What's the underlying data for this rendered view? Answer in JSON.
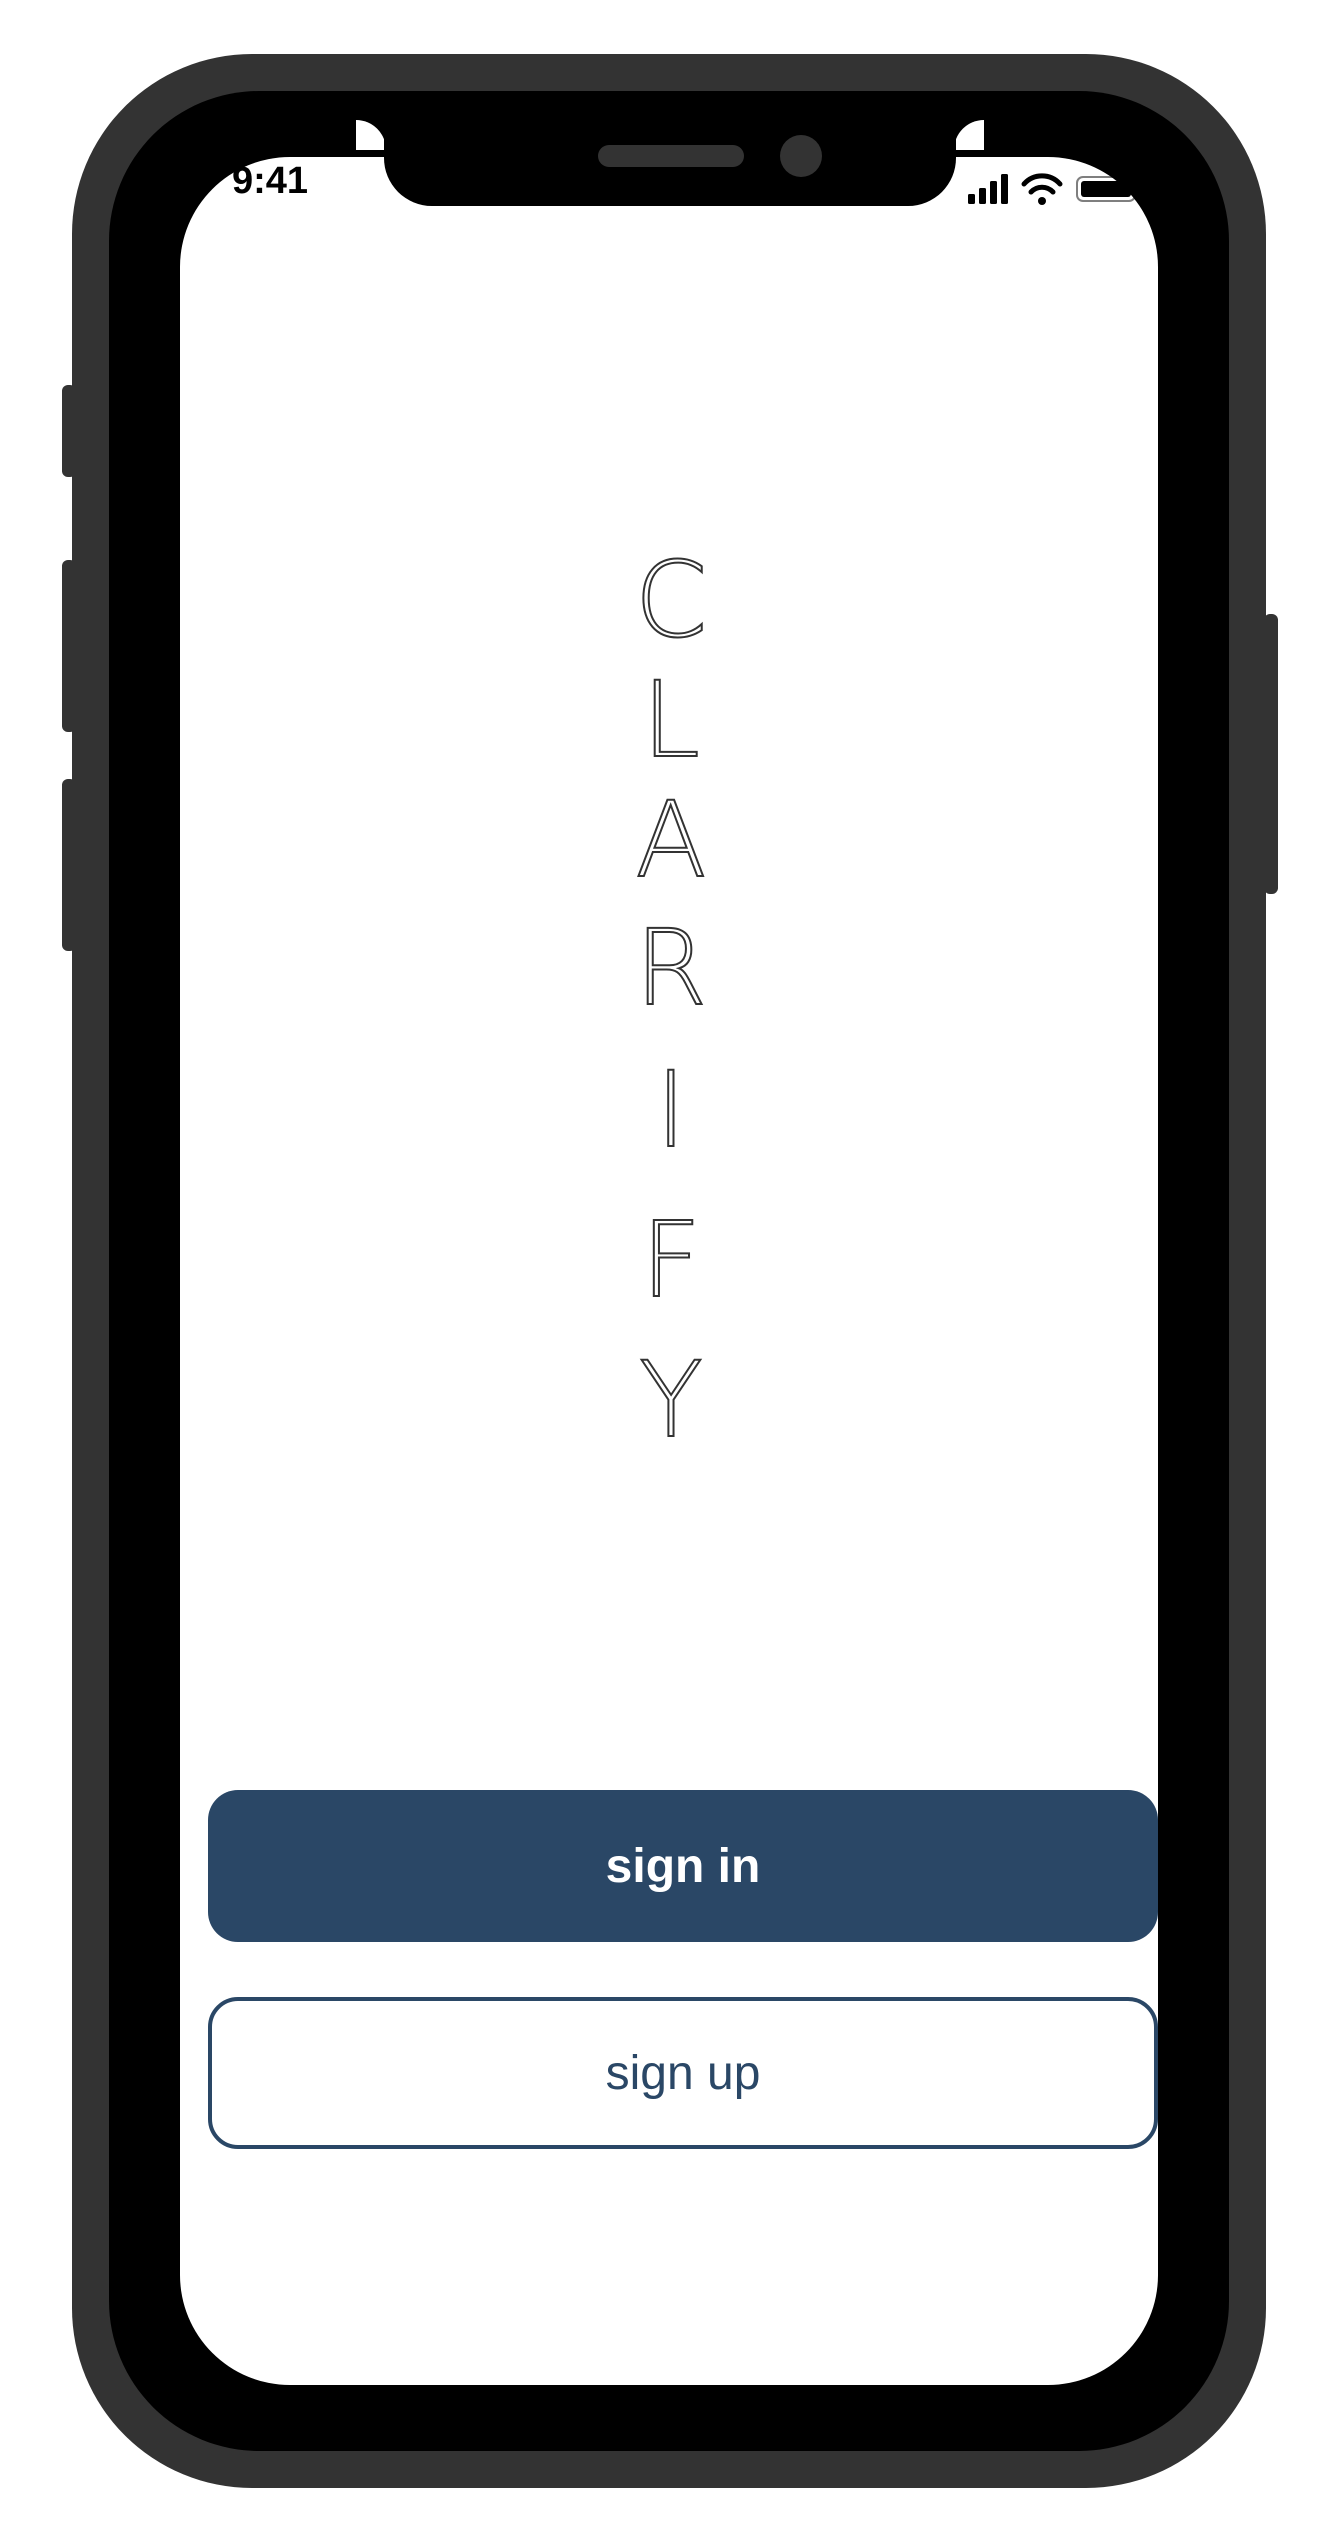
{
  "status_bar": {
    "time": "9:41",
    "icons": [
      "signal-icon",
      "wifi-icon",
      "battery-icon"
    ]
  },
  "brand": {
    "wordmark_letters": [
      "C",
      "L",
      "A",
      "R",
      "I",
      "F",
      "Y"
    ],
    "text_color": "#333333"
  },
  "actions": {
    "sign_in_label": "sign in",
    "sign_up_label": "sign up",
    "primary_color": "#2a4766"
  },
  "device": {
    "frame_color": "#333333"
  }
}
